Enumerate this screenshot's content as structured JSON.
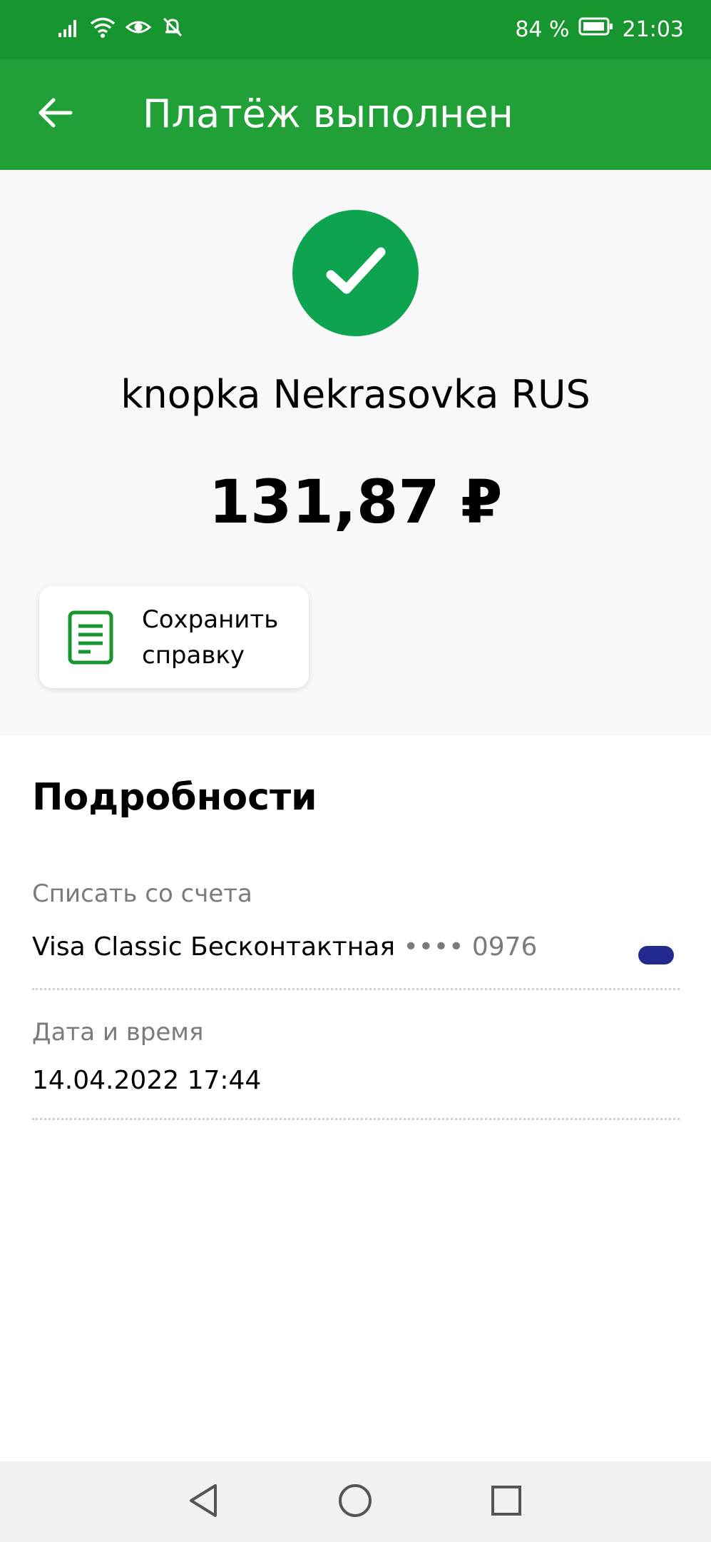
{
  "status_bar": {
    "battery": "84 %",
    "time": "21:03",
    "icons": [
      "signal-icon",
      "wifi-icon",
      "eye-icon",
      "bell-off-icon",
      "battery-icon"
    ]
  },
  "header": {
    "title": "Платёж выполнен",
    "back_icon": "arrow-left-icon"
  },
  "payment": {
    "status_icon": "checkmark-icon",
    "recipient": "knopka Nekrasovka RUS",
    "amount": "131,87 ₽"
  },
  "actions": {
    "save_receipt_line1": "Сохранить",
    "save_receipt_line2": "справку",
    "save_icon": "document-icon"
  },
  "details": {
    "title": "Подробности",
    "account_label": "Списать со счета",
    "account_name": "Visa Classic Бесконтактная",
    "account_masked": "•••• 0976",
    "datetime_label": "Дата и время",
    "datetime_value": "14.04.2022 17:44"
  },
  "colors": {
    "status_bar": "#17962f",
    "app_bar": "#21a038",
    "success": "#0ea44f",
    "card_chip": "#222a8f"
  },
  "nav_bar": {
    "icons": [
      "back-triangle-icon",
      "home-circle-icon",
      "recents-square-icon"
    ]
  }
}
